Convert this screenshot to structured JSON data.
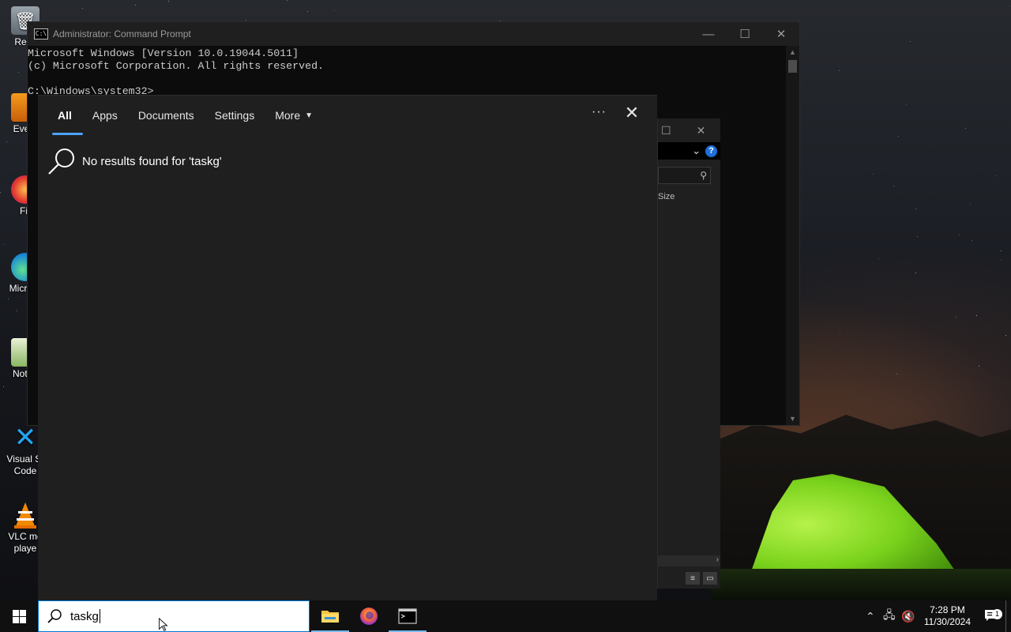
{
  "desktop": {
    "icons": [
      {
        "label": "Recy",
        "icon": "recycle-bin-icon"
      },
      {
        "label": "Every",
        "icon": "everything-icon"
      },
      {
        "label": "Fir",
        "icon": "firefox-icon"
      },
      {
        "label": "Micr Ed",
        "icon": "edge-icon"
      },
      {
        "label": "Notep",
        "icon": "notepad-icon"
      },
      {
        "label": "Visual St Code",
        "icon": "vscode-icon"
      },
      {
        "label": "VLC me playe",
        "icon": "vlc-icon"
      }
    ]
  },
  "cmd": {
    "title": "Administrator: Command Prompt",
    "lines": [
      "Microsoft Windows [Version 10.0.19044.5011]",
      "(c) Microsoft Corporation. All rights reserved.",
      "",
      "C:\\Windows\\system32>"
    ]
  },
  "explorer": {
    "column_header": "Size"
  },
  "search": {
    "tabs": [
      {
        "label": "All",
        "active": true
      },
      {
        "label": "Apps"
      },
      {
        "label": "Documents"
      },
      {
        "label": "Settings"
      },
      {
        "label": "More"
      }
    ],
    "no_results": "No results found for 'taskg'",
    "query": "taskg"
  },
  "taskbar": {
    "pinned": [
      "file-explorer-icon",
      "firefox-icon",
      "command-prompt-icon"
    ],
    "clock_time": "7:28 PM",
    "clock_date": "11/30/2024",
    "notification_count": "1"
  },
  "colors": {
    "accent": "#0078d7",
    "tab_underline": "#4ba3ff",
    "panel_bg": "#1f1f1f"
  }
}
